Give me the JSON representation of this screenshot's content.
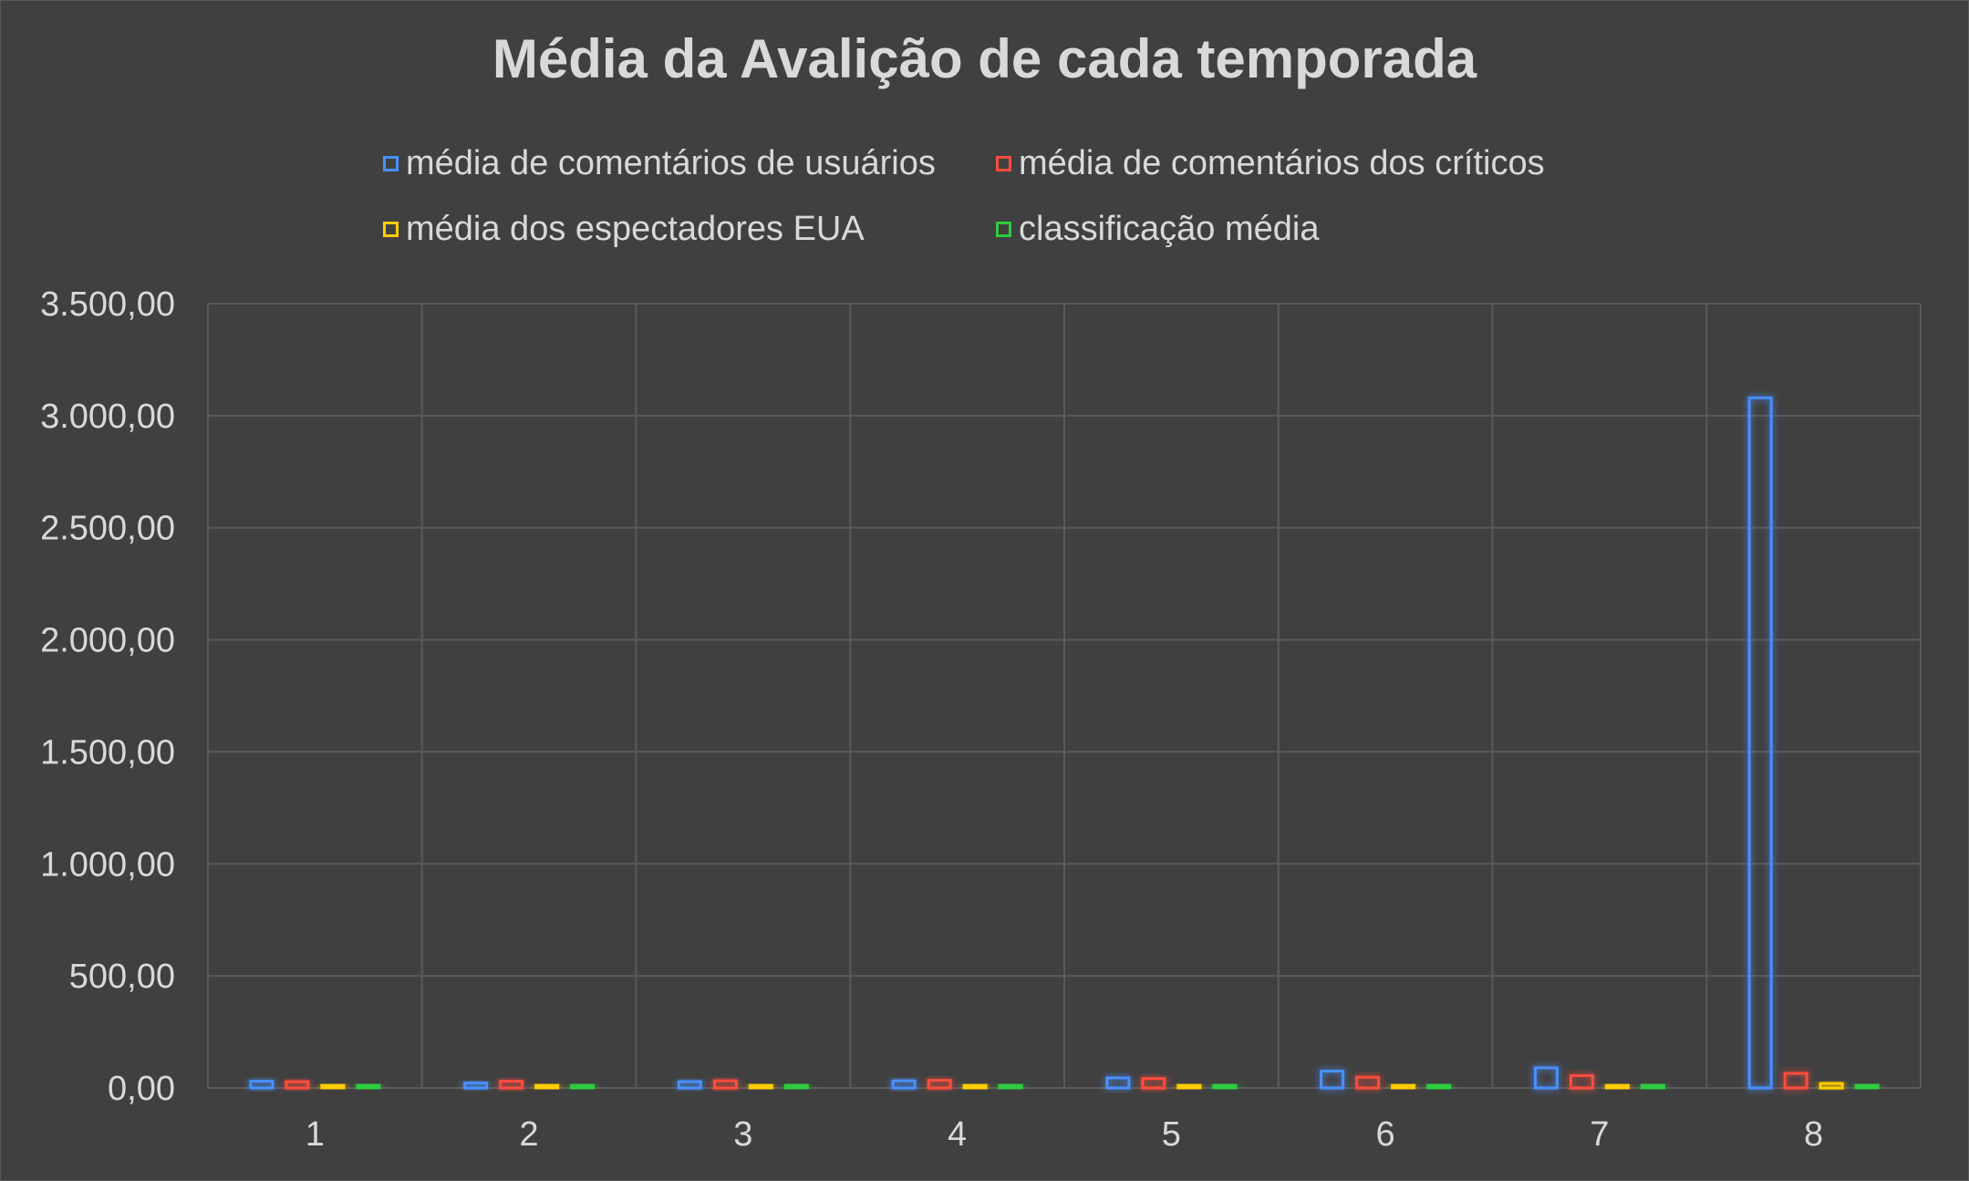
{
  "chart_data": {
    "type": "bar",
    "title": "Média da Avalição de cada temporada",
    "xlabel": "",
    "ylabel": "",
    "categories": [
      "1",
      "2",
      "3",
      "4",
      "5",
      "6",
      "7",
      "8"
    ],
    "ylim": [
      0,
      3500
    ],
    "y_ticks": [
      "0,00",
      "500,00",
      "1.000,00",
      "1.500,00",
      "2.000,00",
      "2.500,00",
      "3.000,00",
      "3.500,00"
    ],
    "grid": true,
    "legend_position": "top",
    "series": [
      {
        "name": "média de comentários de usuários",
        "color": "#4a90ff",
        "values": [
          30,
          22,
          28,
          32,
          45,
          75,
          90,
          3080
        ]
      },
      {
        "name": "média de comentários dos críticos",
        "color": "#ff4d3d",
        "values": [
          28,
          30,
          32,
          34,
          42,
          48,
          55,
          65
        ]
      },
      {
        "name": "média dos espectadores EUA",
        "color": "#ffcc00",
        "values": [
          12,
          12,
          12,
          12,
          12,
          12,
          12,
          20
        ]
      },
      {
        "name": "classificação média",
        "color": "#2ecc40",
        "values": [
          9,
          9,
          9,
          9,
          9,
          9,
          9,
          8
        ]
      }
    ]
  }
}
